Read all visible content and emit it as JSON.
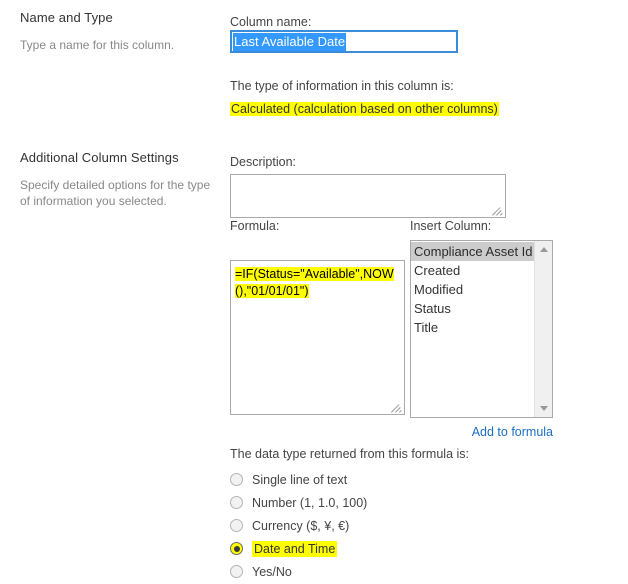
{
  "left_panel": {
    "sections": [
      {
        "title": "Name and Type",
        "description": "Type a name for this column."
      },
      {
        "title": "Additional Column Settings",
        "description": "Specify detailed options for the type of information you selected."
      }
    ]
  },
  "form": {
    "column_name_label": "Column name:",
    "column_name_value": "Last Available Date",
    "type_of_information_label": "The type of information in this column is:",
    "type_of_information_value": "Calculated (calculation based on other columns)",
    "description_label": "Description:",
    "description_value": "",
    "formula_label": "Formula:",
    "formula_value": "=IF(Status=\"Available\",NOW(),\"01/01/01\")",
    "insert_column_label": "Insert Column:",
    "insert_column_options": [
      "Compliance Asset Id",
      "Created",
      "Modified",
      "Status",
      "Title"
    ],
    "insert_column_selected": "Compliance Asset Id",
    "add_to_formula_link": "Add to formula",
    "data_type_label": "The data type returned from this formula is:",
    "data_type_options": [
      {
        "label": "Single line of text",
        "checked": false,
        "highlighted": false
      },
      {
        "label": "Number (1, 1.0, 100)",
        "checked": false,
        "highlighted": false
      },
      {
        "label": "Currency ($, ¥, €)",
        "checked": false,
        "highlighted": false
      },
      {
        "label": "Date and Time",
        "checked": true,
        "highlighted": true
      },
      {
        "label": "Yes/No",
        "checked": false,
        "highlighted": false
      }
    ]
  },
  "colors": {
    "highlight": "#ffff00",
    "selection": "#3399ff",
    "focus_border": "#3a8bd8",
    "link": "#1b6ec2"
  }
}
